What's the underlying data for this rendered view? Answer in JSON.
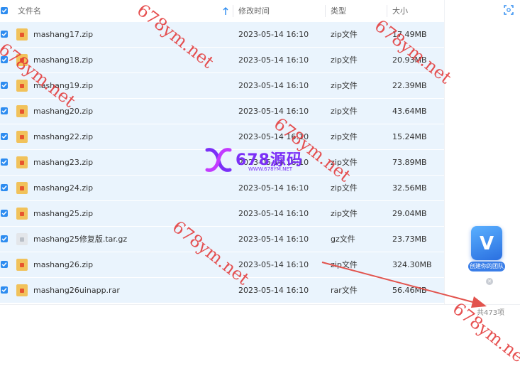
{
  "table": {
    "columns": [
      "文件名",
      "修改时间",
      "类型",
      "大小"
    ],
    "rows": [
      {
        "name": "mashang17.zip",
        "modified": "2023-05-14 16:10",
        "type": "zip文件",
        "size": "17.49MB",
        "icon": "zip-archive-icon"
      },
      {
        "name": "mashang18.zip",
        "modified": "2023-05-14 16:10",
        "type": "zip文件",
        "size": "20.93MB",
        "icon": "zip-archive-icon"
      },
      {
        "name": "mashang19.zip",
        "modified": "2023-05-14 16:10",
        "type": "zip文件",
        "size": "22.39MB",
        "icon": "zip-archive-icon"
      },
      {
        "name": "mashang20.zip",
        "modified": "2023-05-14 16:10",
        "type": "zip文件",
        "size": "43.64MB",
        "icon": "zip-archive-icon"
      },
      {
        "name": "mashang22.zip",
        "modified": "2023-05-14 16:10",
        "type": "zip文件",
        "size": "15.24MB",
        "icon": "zip-archive-icon"
      },
      {
        "name": "mashang23.zip",
        "modified": "2023-05-14 16:10",
        "type": "zip文件",
        "size": "73.89MB",
        "icon": "zip-archive-icon"
      },
      {
        "name": "mashang24.zip",
        "modified": "2023-05-14 16:10",
        "type": "zip文件",
        "size": "32.56MB",
        "icon": "zip-archive-icon"
      },
      {
        "name": "mashang25.zip",
        "modified": "2023-05-14 16:10",
        "type": "zip文件",
        "size": "29.04MB",
        "icon": "zip-archive-icon"
      },
      {
        "name": "mashang25修复版.tar.gz",
        "modified": "2023-05-14 16:10",
        "type": "gz文件",
        "size": "23.73MB",
        "icon": "gz-archive-icon"
      },
      {
        "name": "mashang26.zip",
        "modified": "2023-05-14 16:10",
        "type": "zip文件",
        "size": "324.30MB",
        "icon": "zip-archive-icon"
      },
      {
        "name": "mashang26uinapp.rar",
        "modified": "2023-05-14 16:10",
        "type": "rar文件",
        "size": "56.46MB",
        "icon": "rar-archive-icon"
      }
    ]
  },
  "footer": {
    "count": "共473项"
  },
  "badge": {
    "letter": "V",
    "label": "创建你的团队"
  },
  "logo": {
    "text": "678源码",
    "url": "WWW.678YM.NET"
  },
  "watermark": {
    "text": "678ym.net"
  },
  "colors": {
    "row_bg": "#eaf4fd",
    "accent": "#2d8cf0",
    "watermark": "#e23838",
    "logo": "#7b2ff7"
  }
}
